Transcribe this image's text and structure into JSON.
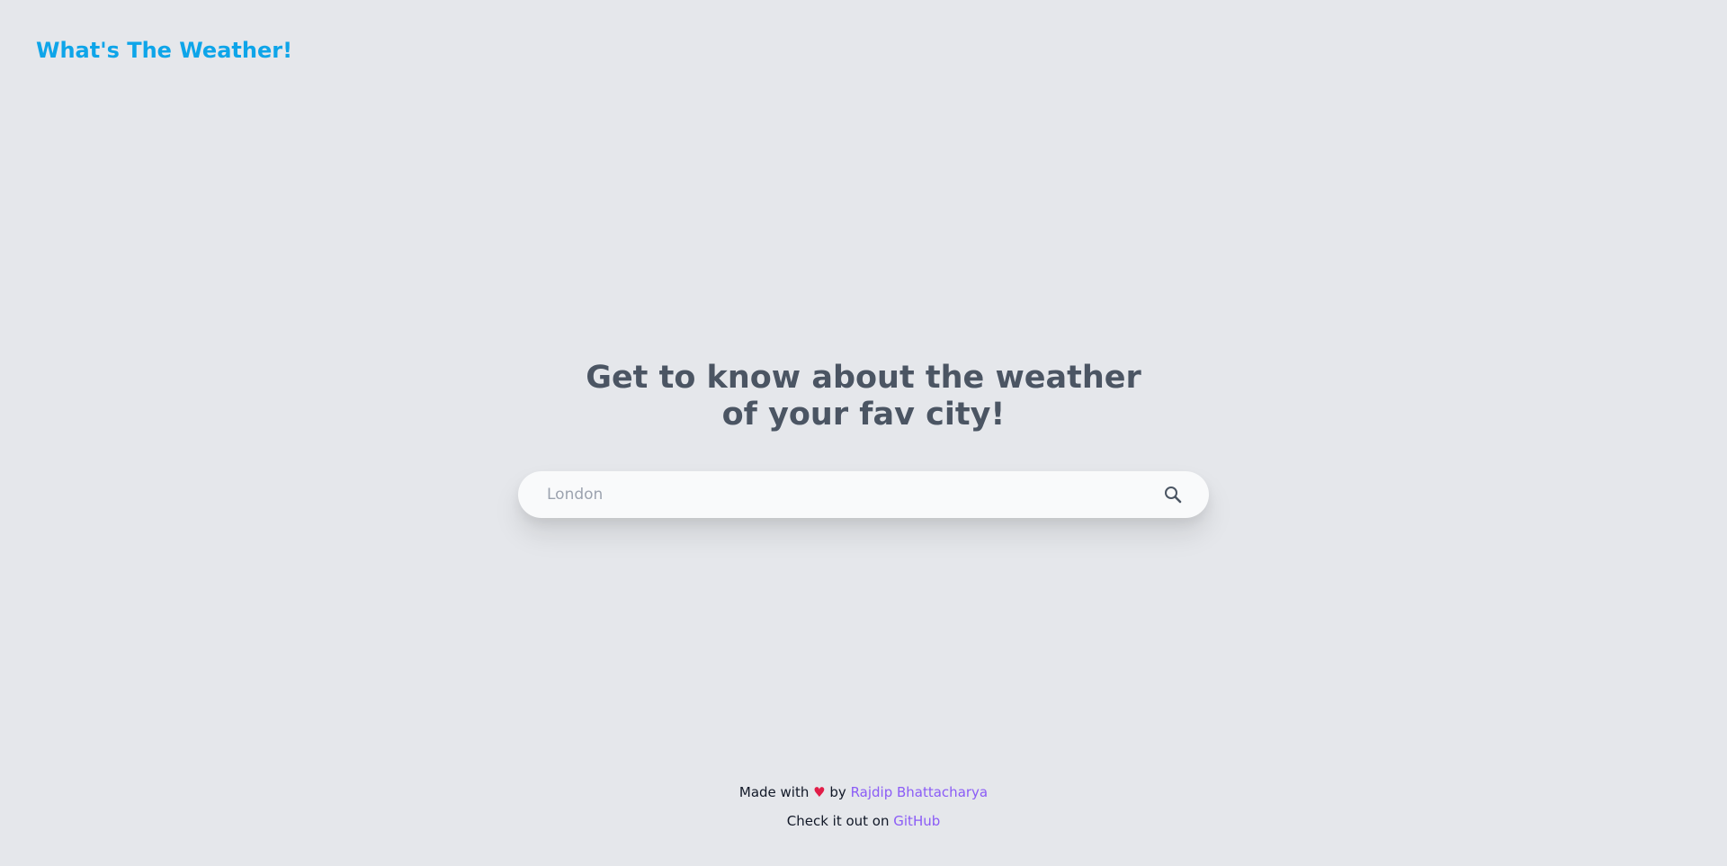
{
  "header": {
    "brand": "What's The Weather!"
  },
  "hero": {
    "headline": "Get to know about the weather of your fav city!"
  },
  "search": {
    "placeholder": "London",
    "value": ""
  },
  "footer": {
    "made_with": "Made with",
    "heart": "♥",
    "by": "by",
    "author": "Rajdip Bhattacharya",
    "check_out": "Check it out on",
    "github": "GitHub"
  },
  "colors": {
    "background": "#e5e7eb",
    "brand": "#0ea5e9",
    "headline": "#4b5563",
    "link": "#8b5cf6",
    "heart": "#e11d48"
  },
  "icons": {
    "search": "search-icon",
    "heart": "heart-icon"
  }
}
